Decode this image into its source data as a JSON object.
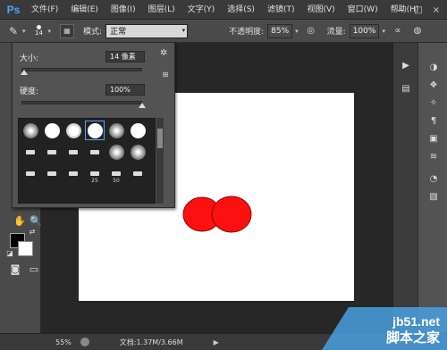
{
  "app": {
    "logo": "Ps"
  },
  "menu": [
    "文件(F)",
    "编辑(E)",
    "图像(I)",
    "图层(L)",
    "文字(Y)",
    "选择(S)",
    "滤镜(T)",
    "视图(V)",
    "窗口(W)",
    "帮助(H)"
  ],
  "window_controls": [
    "—",
    "□",
    "×"
  ],
  "options_bar": {
    "brush_size": "14",
    "mode_label": "模式:",
    "mode_value": "正常",
    "opacity_label": "不透明度:",
    "opacity_value": "85%",
    "flow_label": "流量:",
    "flow_value": "100%"
  },
  "brush_popup": {
    "size_label": "大小:",
    "size_value": "14 像素",
    "hardness_label": "硬度:",
    "hardness_value": "100%",
    "size_fraction": 0.02,
    "hardness_fraction": 1.0,
    "preset_numbers": [
      "25",
      "50"
    ]
  },
  "colors": {
    "foreground": "#000000",
    "background": "#ffffff",
    "stroke_fill": "#ff1010",
    "arrow": "#e03030"
  },
  "status": {
    "zoom": "55%",
    "doc": "文档:1.37M/3.66M"
  },
  "watermark": {
    "line1": "jb51.net",
    "line2": "脚本之家"
  }
}
